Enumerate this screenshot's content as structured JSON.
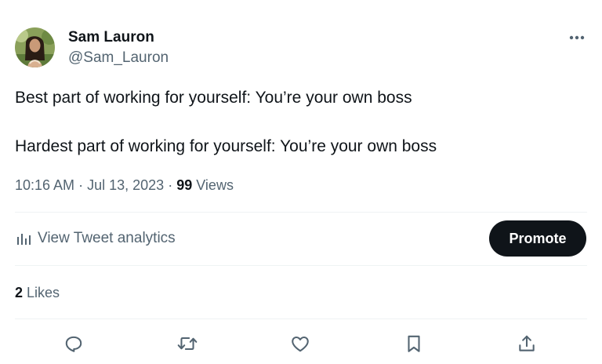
{
  "author": {
    "name": "Sam Lauron",
    "handle": "@Sam_Lauron",
    "avatar_icon": "profile-photo"
  },
  "tweet": {
    "line1": "Best part of working for yourself: You’re your own boss",
    "line2": "Hardest part of working for yourself: You’re your own boss"
  },
  "meta": {
    "time": "10:16 AM",
    "sep1": "·",
    "date": "Jul 13, 2023",
    "sep2": "·",
    "views_count": "99",
    "views_label": "Views"
  },
  "analytics": {
    "label": "View Tweet analytics",
    "icon": "bar-chart-icon"
  },
  "promote": {
    "label": "Promote"
  },
  "likes": {
    "count": "2",
    "label": "Likes"
  },
  "actions": [
    "reply-icon",
    "retweet-icon",
    "like-icon",
    "bookmark-icon",
    "share-icon"
  ],
  "colors": {
    "text": "#0f1419",
    "secondary": "#536471",
    "divider": "#eff3f4",
    "button_bg": "#0f1419",
    "button_text": "#ffffff"
  }
}
